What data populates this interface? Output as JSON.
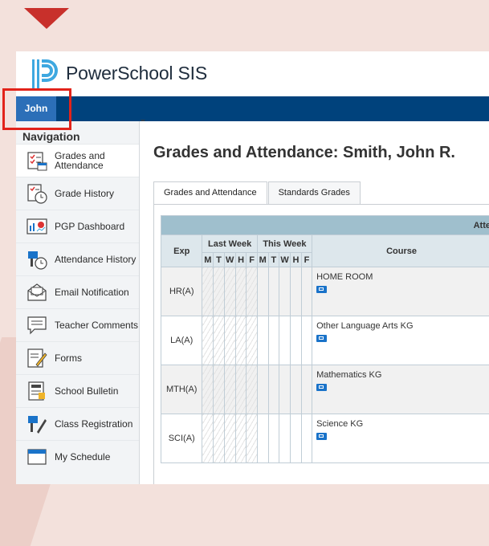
{
  "app": {
    "brand": "PowerSchool SIS"
  },
  "navbar": {
    "user_tab": "John"
  },
  "sidebar": {
    "title": "Navigation",
    "items": [
      {
        "label": "Grades and Attendance",
        "icon": "grades-attendance-icon"
      },
      {
        "label": "Grade History",
        "icon": "grade-history-icon"
      },
      {
        "label": "PGP Dashboard",
        "icon": "pgp-dashboard-icon"
      },
      {
        "label": "Attendance History",
        "icon": "attendance-history-icon"
      },
      {
        "label": "Email Notification",
        "icon": "email-icon"
      },
      {
        "label": "Teacher Comments",
        "icon": "comments-icon"
      },
      {
        "label": "Forms",
        "icon": "forms-icon"
      },
      {
        "label": "School Bulletin",
        "icon": "bulletin-icon"
      },
      {
        "label": "Class Registration",
        "icon": "class-registration-icon"
      },
      {
        "label": "My Schedule",
        "icon": "schedule-icon"
      }
    ]
  },
  "main": {
    "title": "Grades and Attendance: Smith, John R.",
    "tabs": [
      {
        "label": "Grades and Attendance",
        "active": true
      },
      {
        "label": "Standards Grades",
        "active": false
      }
    ],
    "table": {
      "group_header": "Atte",
      "headers": {
        "exp": "Exp",
        "last_week": "Last Week",
        "this_week": "This Week",
        "course": "Course"
      },
      "days": [
        "M",
        "T",
        "W",
        "H",
        "F"
      ],
      "rows": [
        {
          "exp": "HR(A)",
          "course": "HOME ROOM"
        },
        {
          "exp": "LA(A)",
          "course": "Other Language Arts KG"
        },
        {
          "exp": "MTH(A)",
          "course": "Mathematics KG"
        },
        {
          "exp": "SCI(A)",
          "course": "Science KG"
        }
      ]
    }
  },
  "colors": {
    "navbar": "#00427c",
    "user_tab": "#2c6fb8",
    "table_header": "#9fbfcd",
    "highlight": "#e2231a"
  }
}
